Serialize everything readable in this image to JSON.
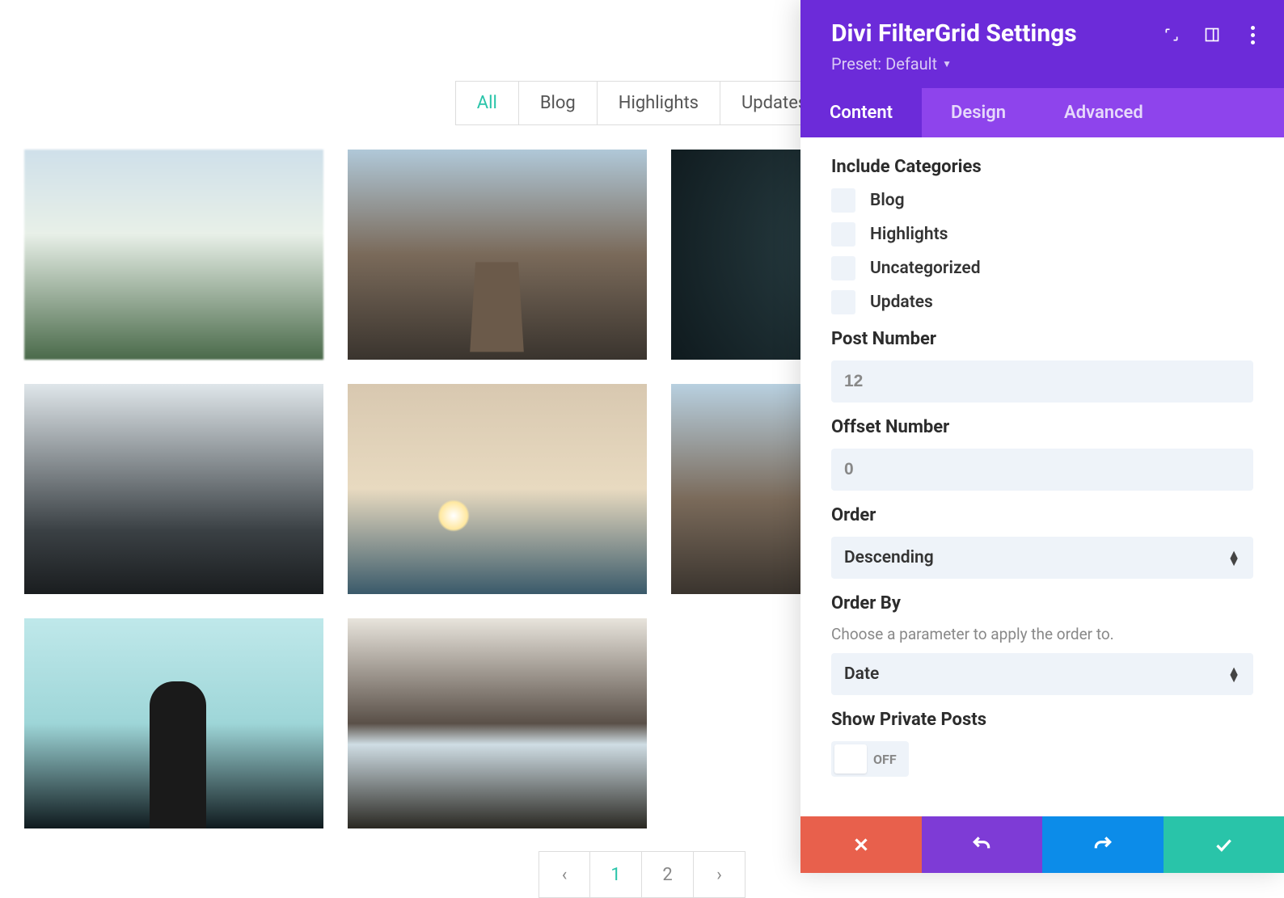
{
  "filters": {
    "items": [
      {
        "label": "All",
        "active": true
      },
      {
        "label": "Blog",
        "active": false
      },
      {
        "label": "Highlights",
        "active": false
      },
      {
        "label": "Updates",
        "active": false
      }
    ]
  },
  "pagination": {
    "prev": "‹",
    "next": "›",
    "pages": [
      "1",
      "2"
    ],
    "current": "1"
  },
  "panel": {
    "title": "Divi FilterGrid Settings",
    "preset": "Preset: Default",
    "tabs": [
      {
        "label": "Content",
        "active": true
      },
      {
        "label": "Design",
        "active": false
      },
      {
        "label": "Advanced",
        "active": false
      }
    ],
    "include_categories_label": "Include Categories",
    "categories": [
      {
        "label": "Blog"
      },
      {
        "label": "Highlights"
      },
      {
        "label": "Uncategorized"
      },
      {
        "label": "Updates"
      }
    ],
    "post_number_label": "Post Number",
    "post_number_value": "12",
    "offset_number_label": "Offset Number",
    "offset_number_value": "0",
    "order_label": "Order",
    "order_value": "Descending",
    "order_by_label": "Order By",
    "order_by_hint": "Choose a parameter to apply the order to.",
    "order_by_value": "Date",
    "show_private_label": "Show Private Posts",
    "show_private_state": "OFF"
  }
}
